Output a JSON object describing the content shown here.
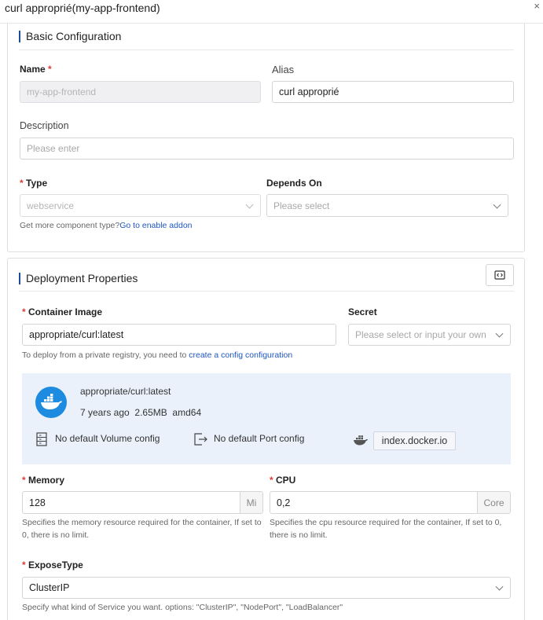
{
  "window": {
    "title": "curl approprié(my-app-frontend)",
    "close_symbol": "×"
  },
  "basic": {
    "section_title": "Basic Configuration",
    "name_label": "Name",
    "name_value": "my-app-frontend",
    "alias_label": "Alias",
    "alias_value": "curl approprié",
    "description_label": "Description",
    "description_placeholder": "Please enter",
    "type_label": "Type",
    "type_value": "webservice",
    "depends_label": "Depends On",
    "depends_placeholder": "Please select",
    "addon_hint": "Get more component type?",
    "addon_link": "Go to enable addon"
  },
  "deploy": {
    "section_title": "Deployment Properties",
    "image_label": "Container Image",
    "image_value": "appropriate/curl:latest",
    "secret_label": "Secret",
    "secret_placeholder": "Please select or input your own",
    "registry_hint": "To deploy from a private registry, you need to ",
    "registry_link": "create a config configuration",
    "image_info": {
      "name": "appropriate/curl:latest",
      "age": "7 years ago",
      "size": "2.65MB",
      "arch": "amd64",
      "volume": "No default Volume config",
      "port": "No default Port config",
      "registry": "index.docker.io"
    },
    "memory_label": "Memory",
    "memory_value": "128",
    "memory_unit": "Mi",
    "memory_hint": "Specifies the memory resource required for the container, If set to 0, there is no limit.",
    "cpu_label": "CPU",
    "cpu_value": "0,2",
    "cpu_unit": "Core",
    "cpu_hint": "Specifies the cpu resource required for the container, If set to 0, there is no limit.",
    "expose_label": "ExposeType",
    "expose_value": "ClusterIP",
    "expose_hint": "Specify what kind of Service you want. options: \"ClusterIP\", \"NodePort\", \"LoadBalancer\""
  },
  "colors": {
    "accent": "#1d4e9e",
    "link": "#1f55c4",
    "required": "#e23b3b",
    "panel_bg": "#eaf1fb",
    "docker_blue": "#1d8ce0"
  }
}
